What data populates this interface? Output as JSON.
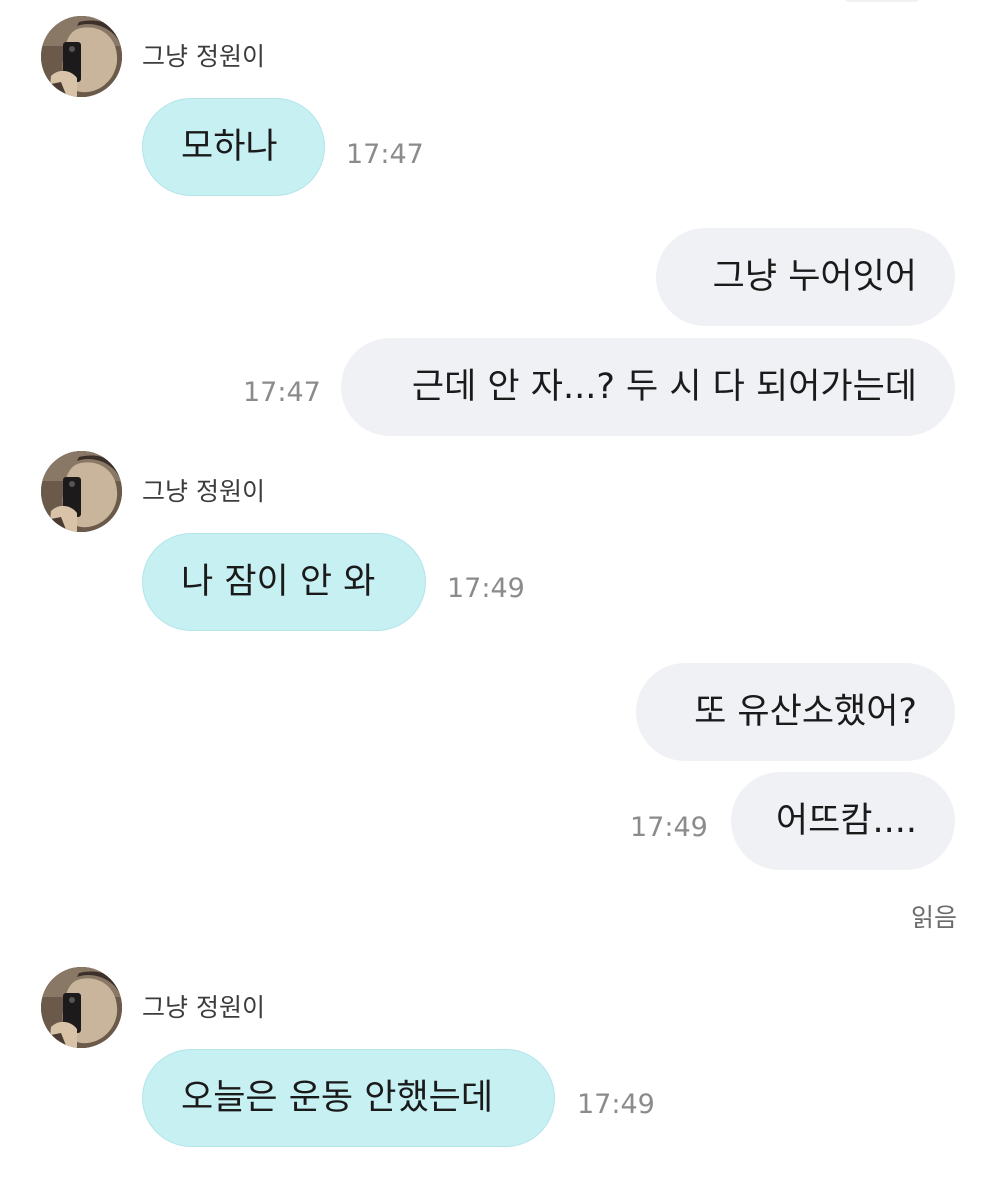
{
  "contact": {
    "name": "그냥 정원이",
    "avatar_icon": "profile-photo-icon"
  },
  "messages": [
    {
      "direction": "in",
      "text": "모하나",
      "time": "17:47"
    },
    {
      "direction": "out",
      "text": "그냥 누어잇어",
      "time": ""
    },
    {
      "direction": "out",
      "text": "근데 안 자...? 두 시 다 되어가는데",
      "time": "17:47"
    },
    {
      "direction": "in",
      "text": "나 잠이 안 와",
      "time": "17:49"
    },
    {
      "direction": "out",
      "text": "또 유산소했어?",
      "time": ""
    },
    {
      "direction": "out",
      "text": "어뜨캄....",
      "time": "17:49"
    },
    {
      "direction": "in",
      "text": "오늘은 운동 안했는데",
      "time": "17:49"
    }
  ],
  "read_receipt": "읽음",
  "colors": {
    "incoming_bubble": "#c7f0f3",
    "outgoing_bubble": "#f0f1f5",
    "timestamp": "#8b8b8b"
  }
}
